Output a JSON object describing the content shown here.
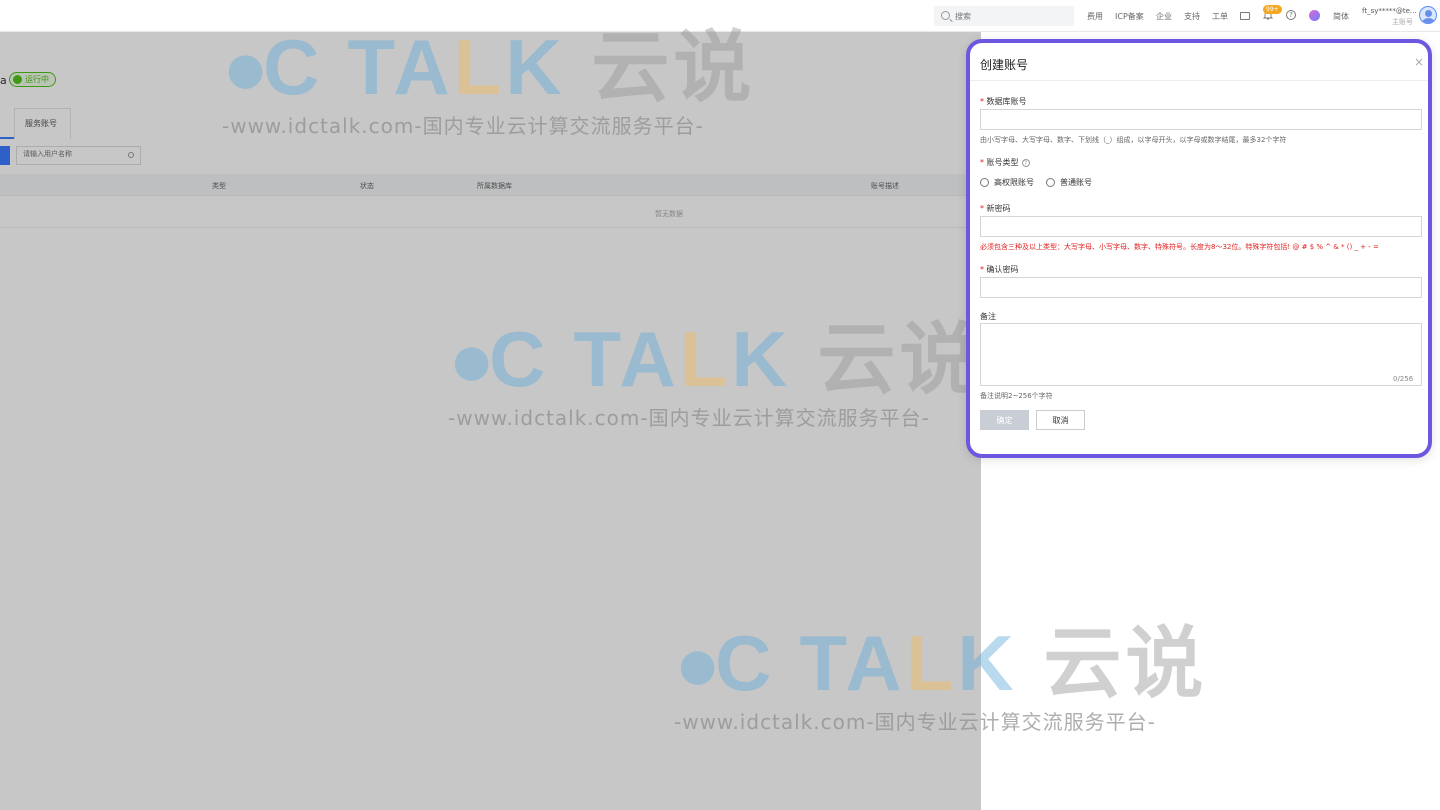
{
  "topbar": {
    "search_placeholder": "搜索",
    "nav": [
      "费用",
      "ICP备案",
      "企业",
      "支持",
      "工单"
    ],
    "notification_badge": "99+",
    "help_glyph": "?",
    "lang_label": "简体",
    "user_name": "ft_sy*****@te...",
    "user_sub": "主账号"
  },
  "background": {
    "title_fragment": "a",
    "status_label": "运行中",
    "tabs": [
      "服务账号"
    ],
    "search_placeholder": "请输入用户名称",
    "columns": [
      "类型",
      "状态",
      "所属数据库",
      "账号描述"
    ],
    "empty_text": "暂无数据"
  },
  "watermark": {
    "logo_blue": "TA",
    "logo_orange": "L",
    "logo_blue2": "K",
    "logo_cn": "云说",
    "subtitle": "-www.idctalk.com-国内专业云计算交流服务平台-"
  },
  "dialog": {
    "title": "创建账号",
    "close_glyph": "×",
    "db_account_label": "数据库账号",
    "db_account_hint": "由小写字母、大写字母、数字、下划线（_）组成，以字母开头，以字母或数字结尾，最多32个字符",
    "account_type_label": "账号类型",
    "account_type_help": "?",
    "account_type_options": [
      "高权限账号",
      "普通账号"
    ],
    "new_password_label": "新密码",
    "new_password_hint": "必须包含三种及以上类型：大写字母、小写字母、数字、特殊符号。长度为8～32位。特殊字符包括! @ # $ % ^ & * () _ + - =",
    "confirm_password_label": "确认密码",
    "remark_label": "备注",
    "remark_counter": "0/256",
    "remark_hint": "备注说明2~256个字符",
    "ok_label": "确定",
    "cancel_label": "取消",
    "required_mark": "*"
  },
  "colors": {
    "accent": "#3b7cff",
    "dialog_border": "#6c58e0",
    "required": "#e02020",
    "status_green": "#52c41a"
  }
}
